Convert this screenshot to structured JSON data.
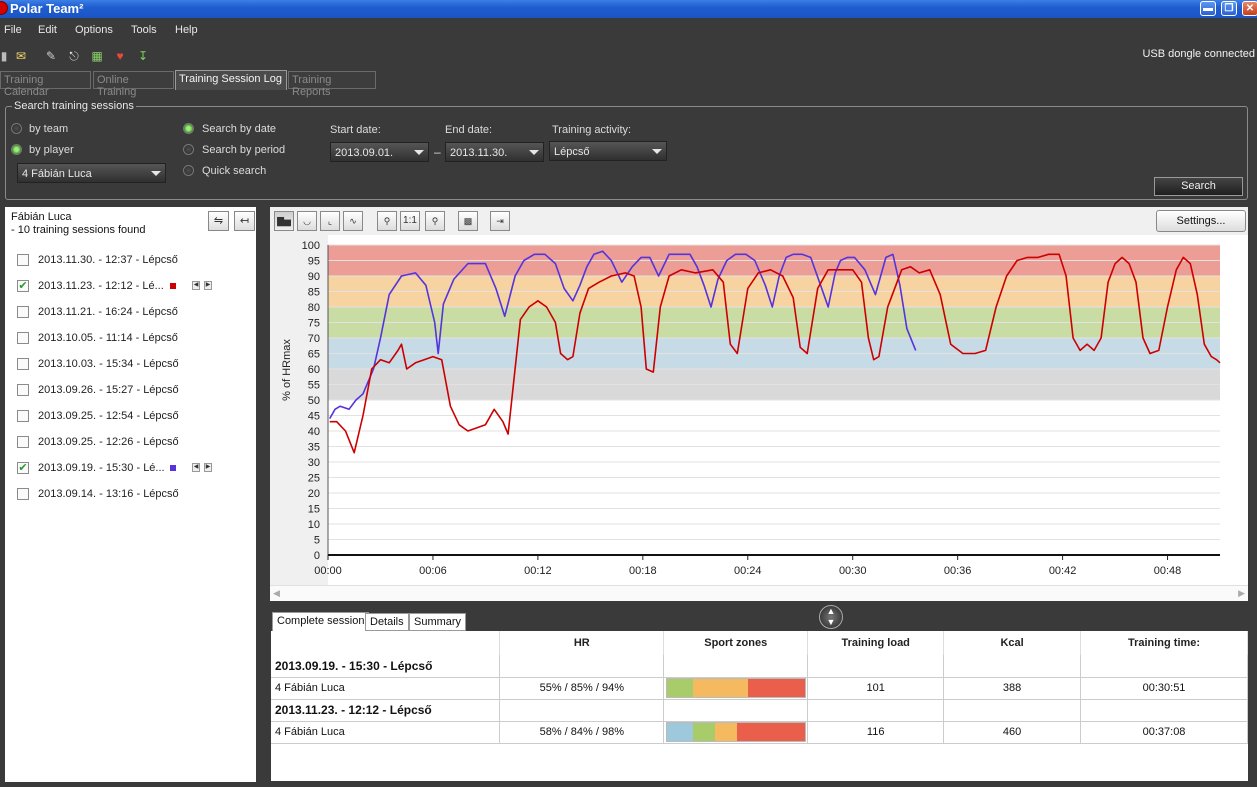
{
  "window": {
    "title": "Polar Team²"
  },
  "menu": [
    "File",
    "Edit",
    "Options",
    "Tools",
    "Help"
  ],
  "status": {
    "usb": "USB dongle connected"
  },
  "tabs": [
    "Training Calendar",
    "Online Training",
    "Training Session Log",
    "Training Reports"
  ],
  "search": {
    "legend": "Search training sessions",
    "by_team": "by team",
    "by_player": "by player",
    "player_value": "4 Fábián Luca",
    "by_date": "Search by date",
    "by_period": "Search by period",
    "quick": "Quick search",
    "start_label": "Start date:",
    "start_value": "2013.09.01.",
    "end_label": "End date:",
    "end_value": "2013.11.30.",
    "activity_label": "Training activity:",
    "activity_value": "Lépcső",
    "dash": "–",
    "button": "Search"
  },
  "sessions_panel": {
    "player": "Fábián Luca",
    "found": "- 10 training sessions found",
    "sessions": [
      {
        "label": "2013.11.30. - 12:37 - Lépcső",
        "checked": false
      },
      {
        "label": "2013.11.23. - 12:12 - Lé...",
        "checked": true,
        "color": "#cc0000"
      },
      {
        "label": "2013.11.21. - 16:24 - Lépcső",
        "checked": false
      },
      {
        "label": "2013.10.05. - 11:14 - Lépcső",
        "checked": false
      },
      {
        "label": "2013.10.03. - 15:34 - Lépcső",
        "checked": false
      },
      {
        "label": "2013.09.26. - 15:27 - Lépcső",
        "checked": false
      },
      {
        "label": "2013.09.25. - 12:54 - Lépcső",
        "checked": false
      },
      {
        "label": "2013.09.25. - 12:26 - Lépcső",
        "checked": false
      },
      {
        "label": "2013.09.19. - 15:30 - Lé...",
        "checked": true,
        "color": "#5533dd"
      },
      {
        "label": "2013.09.14. - 13:16 - Lépcső",
        "checked": false
      }
    ]
  },
  "chart_toolbar": {
    "settings": "Settings...",
    "zoom_reset": "1:1"
  },
  "chart_data": {
    "type": "line",
    "ylabel": "% of HRmax",
    "ylim": [
      0,
      100
    ],
    "y_ticks": [
      0,
      5,
      10,
      15,
      20,
      25,
      30,
      35,
      40,
      45,
      50,
      55,
      60,
      65,
      70,
      75,
      80,
      85,
      90,
      95,
      100
    ],
    "x_unit": "minutes",
    "xlim": [
      0,
      51
    ],
    "x_ticks": [
      "00:00",
      "00:06",
      "00:12",
      "00:18",
      "00:24",
      "00:30",
      "00:36",
      "00:42",
      "00:48"
    ],
    "zones": [
      {
        "from": 90,
        "to": 100,
        "color": "#ec9e96"
      },
      {
        "from": 80,
        "to": 90,
        "color": "#f6d3a0"
      },
      {
        "from": 70,
        "to": 80,
        "color": "#c8dca4"
      },
      {
        "from": 60,
        "to": 70,
        "color": "#c6dbe6"
      },
      {
        "from": 50,
        "to": 60,
        "color": "#d9d9d9"
      }
    ],
    "series": [
      {
        "session": "2013.09.19. - 15:30",
        "color": "#5533dd",
        "x": [
          0.1,
          0.4,
          0.7,
          1.2,
          1.6,
          2.0,
          2.6,
          3.0,
          3.5,
          4.2,
          5.0,
          5.6,
          6.1,
          6.3,
          6.6,
          7.2,
          8.0,
          9.0,
          9.6,
          10.1,
          10.7,
          11.2,
          11.8,
          12.4,
          13.0,
          13.5,
          14.0,
          14.4,
          14.8,
          15.2,
          15.7,
          16.2,
          16.8,
          17.4,
          17.9,
          18.4,
          18.9,
          19.5,
          20.1,
          20.7,
          21.1,
          21.5,
          21.9,
          22.3,
          22.8,
          23.3,
          23.9,
          24.4,
          25.0,
          25.4,
          25.8,
          26.2,
          26.6,
          27.1,
          27.6,
          28.1,
          28.6,
          29.0,
          29.3,
          29.7,
          30.1,
          30.7,
          31.3,
          31.9,
          32.3,
          32.7,
          33.1,
          33.6
        ],
        "y": [
          44,
          47,
          48,
          47,
          50,
          52,
          60,
          70,
          84,
          90,
          91,
          87,
          75,
          65,
          81,
          89,
          94,
          94,
          86,
          77,
          90,
          95,
          97,
          97,
          94,
          86,
          82,
          87,
          93,
          97,
          98,
          95,
          88,
          93,
          96,
          96,
          90,
          97,
          97,
          97,
          93,
          87,
          80,
          89,
          95,
          97,
          97,
          95,
          87,
          80,
          90,
          96,
          97,
          97,
          96,
          88,
          80,
          91,
          95,
          96,
          96,
          92,
          84,
          96,
          97,
          87,
          73,
          66
        ]
      },
      {
        "session": "2013.11.23. - 12:12",
        "color": "#cc0000",
        "x": [
          0.1,
          0.5,
          1.0,
          1.5,
          2.0,
          2.5,
          3.0,
          3.5,
          4.0,
          4.2,
          4.5,
          5.0,
          5.5,
          6.0,
          6.5,
          7.0,
          7.5,
          8.0,
          8.5,
          9.0,
          9.5,
          10.0,
          10.3,
          10.6,
          11.0,
          11.5,
          12.0,
          12.5,
          13.0,
          13.3,
          13.7,
          14.0,
          14.4,
          14.9,
          15.5,
          16.2,
          17.0,
          17.5,
          17.9,
          18.2,
          18.6,
          19.0,
          19.5,
          20.2,
          21.0,
          22.0,
          22.6,
          23.0,
          23.4,
          24.0,
          24.6,
          25.3,
          26.0,
          26.6,
          27.0,
          27.4,
          28.0,
          28.6,
          29.3,
          30.0,
          30.5,
          30.9,
          31.2,
          31.5,
          32.0,
          32.8,
          33.3,
          33.8,
          34.4,
          35.0,
          35.6,
          36.3,
          37.0,
          37.6,
          38.2,
          38.8,
          39.4,
          40.0,
          40.6,
          41.2,
          41.8,
          42.2,
          42.6,
          43.0,
          43.4,
          43.8,
          44.2,
          44.6,
          45.0,
          45.4,
          45.8,
          46.2,
          46.6,
          47.0,
          47.5,
          48.0,
          48.5,
          48.9,
          49.3,
          49.7,
          50.1,
          50.5,
          50.8,
          51.0
        ],
        "y": [
          43,
          43,
          40,
          33,
          45,
          60,
          63,
          62,
          66,
          68,
          60,
          62,
          63,
          64,
          63,
          48,
          42,
          40,
          41,
          42,
          47,
          43,
          39,
          55,
          76,
          80,
          82,
          80,
          75,
          65,
          63,
          64,
          78,
          86,
          88,
          90,
          91,
          90,
          80,
          60,
          59,
          80,
          90,
          92,
          91,
          92,
          88,
          68,
          65,
          86,
          91,
          92,
          90,
          83,
          67,
          65,
          86,
          92,
          92,
          92,
          88,
          70,
          63,
          64,
          80,
          92,
          93,
          91,
          92,
          84,
          68,
          65,
          65,
          66,
          80,
          90,
          95,
          96,
          96,
          97,
          97,
          90,
          70,
          66,
          68,
          66,
          70,
          88,
          94,
          96,
          94,
          88,
          70,
          65,
          66,
          80,
          92,
          96,
          94,
          84,
          68,
          64,
          63,
          62
        ]
      }
    ]
  },
  "bottom_tabs": [
    "Complete session",
    "Details",
    "Summary"
  ],
  "summary": {
    "headers": [
      "",
      "HR",
      "Sport zones",
      "Training load",
      "Kcal",
      "Training time:"
    ],
    "sessions": [
      {
        "title": "2013.09.19. - 15:30 - Lépcső",
        "player": "4 Fábián Luca",
        "hr": "55% / 85% / 94%",
        "zones": [
          {
            "color": "#a9cc6a",
            "pct": 19
          },
          {
            "color": "#f5b95f",
            "pct": 40
          },
          {
            "color": "#ea5f4b",
            "pct": 41
          }
        ],
        "load": "101",
        "kcal": "388",
        "time": "00:30:51"
      },
      {
        "title": "2013.11.23. - 12:12 - Lépcső",
        "player": "4 Fábián Luca",
        "hr": "58% / 84% / 98%",
        "zones": [
          {
            "color": "#9ec8dc",
            "pct": 19
          },
          {
            "color": "#a9cc6a",
            "pct": 16
          },
          {
            "color": "#f5b95f",
            "pct": 16
          },
          {
            "color": "#ea5f4b",
            "pct": 49
          }
        ],
        "load": "116",
        "kcal": "460",
        "time": "00:37:08"
      }
    ]
  }
}
